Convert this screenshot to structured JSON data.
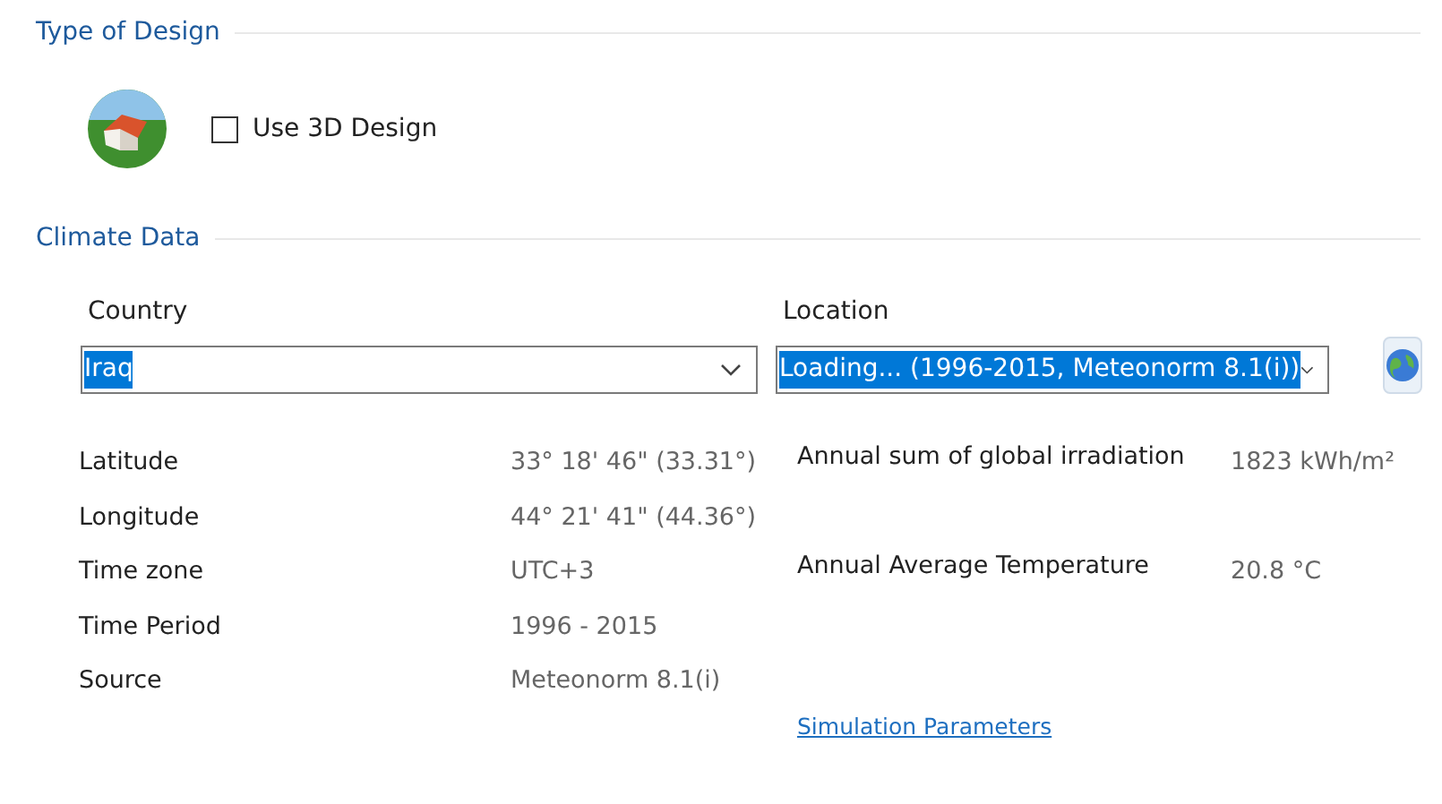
{
  "design": {
    "title": "Type of Design",
    "use_3d": {
      "label": "Use 3D Design",
      "checked": false
    }
  },
  "climate": {
    "title": "Climate Data",
    "country": {
      "label": "Country",
      "value": "Iraq",
      "highlighted": true
    },
    "location": {
      "label": "Location",
      "value": "Loading... (1996-2015, Meteonorm 8.1(i))",
      "highlighted": true
    },
    "info": [
      {
        "label": "Latitude",
        "value": "33° 18' 46\"  (33.31°)"
      },
      {
        "label": "Longitude",
        "value": "44° 21' 41\"  (44.36°)"
      },
      {
        "label": "Time zone",
        "value": "UTC+3"
      },
      {
        "label": "Time Period",
        "value": "1996 - 2015"
      },
      {
        "label": "Source",
        "value": "Meteonorm 8.1(i)"
      }
    ],
    "results": [
      {
        "label": "Annual sum of global irradiation",
        "value": "1823 kWh/m²"
      },
      {
        "label": "Annual Average Temperature",
        "value": "20.8 °C"
      }
    ],
    "link": "Simulation Parameters"
  }
}
